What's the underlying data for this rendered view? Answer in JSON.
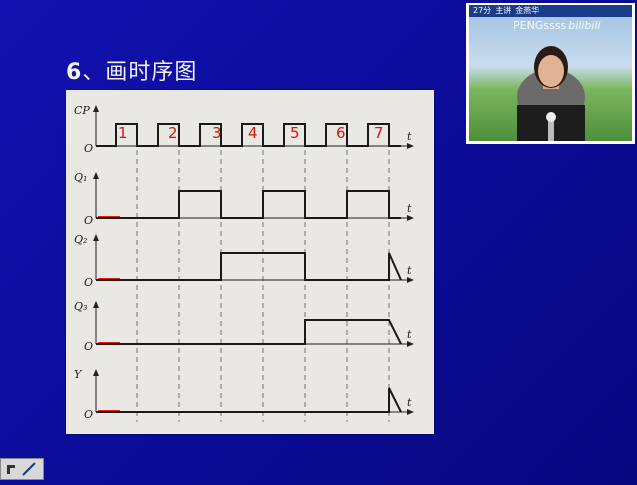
{
  "slide": {
    "title_num": "6",
    "title_text": "、画时序图"
  },
  "video": {
    "caption_time": "27分",
    "caption_role": "主讲",
    "caption_name": "金燕华",
    "watermark": "PENGssss",
    "watermark_logo": "bilibili"
  },
  "timing": {
    "rows": [
      "CP",
      "Q₁",
      "Q₂",
      "Q₃",
      "Y"
    ],
    "origin_label": "O",
    "time_label": "t",
    "clock_pulses": 7,
    "handwritten": [
      "1",
      "2",
      "3",
      "4",
      "5",
      "6",
      "7"
    ],
    "q1": [
      0,
      1,
      0,
      1,
      0,
      1,
      0
    ],
    "q2": [
      0,
      0,
      1,
      1,
      0,
      0,
      1
    ],
    "q3": [
      0,
      0,
      0,
      0,
      1,
      1,
      1
    ],
    "y": [
      0,
      0,
      0,
      0,
      0,
      0,
      1
    ]
  },
  "colors": {
    "background": "#0c0c9a",
    "title_text": "#f2f2f2",
    "waveform": "#1a1a1a",
    "initial_mark": "#e02010",
    "handwriting": "#d01a10"
  }
}
